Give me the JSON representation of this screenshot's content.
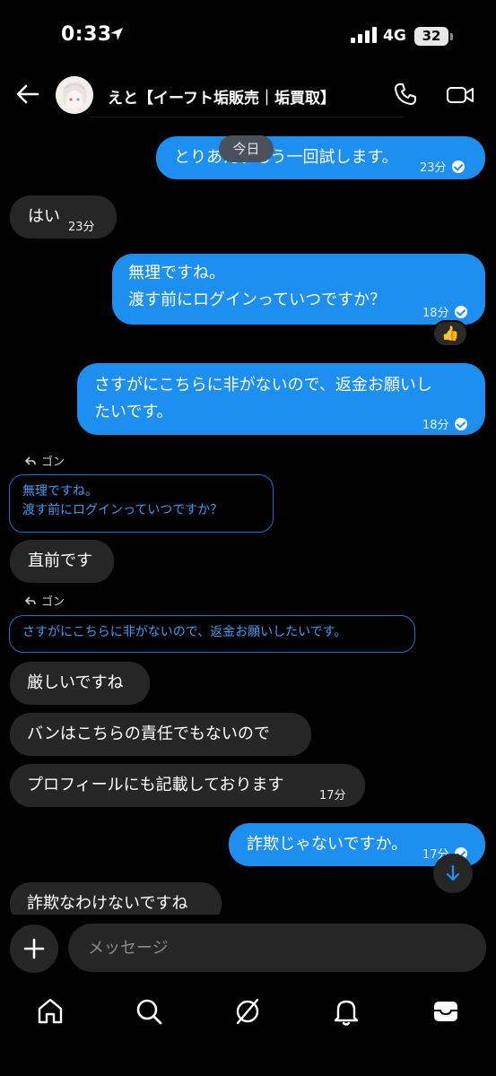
{
  "status_bar": {
    "time": "0:33",
    "network": "4G",
    "battery": "32"
  },
  "header": {
    "contact_name": "えと【イーフト垢販売｜垢買取】"
  },
  "chat": {
    "date_divider": "今日",
    "messages": [
      {
        "direction": "out",
        "text": "とりあえずもう一回試します。",
        "time": "23分",
        "read": true
      },
      {
        "direction": "in",
        "text": "はい",
        "time": "23分"
      },
      {
        "direction": "out",
        "lines": [
          "無理ですね。",
          "渡す前にログインっていつですか？"
        ],
        "time": "18分",
        "read": true,
        "reaction": "👍"
      },
      {
        "direction": "out",
        "lines": [
          "さすがにこちらに非がないので、返金お願いし",
          "たいです。"
        ],
        "time": "18分",
        "read": true
      },
      {
        "direction": "in",
        "reply_label": "ゴン",
        "quote_lines": [
          "無理ですね。",
          "渡す前にログインっていつですか？"
        ],
        "text": "直前です"
      },
      {
        "direction": "in",
        "reply_label": "ゴン",
        "quote_lines": [
          "さすがにこちらに非がないので、返金お願いしたいです。"
        ],
        "text": "厳しいですね"
      },
      {
        "direction": "in",
        "text": "バンはこちらの責任でもないので"
      },
      {
        "direction": "in",
        "text": "プロフィールにも記載しております",
        "time": "17分"
      },
      {
        "direction": "out",
        "text": "詐欺じゃないですか。",
        "time": "17分",
        "read": true
      },
      {
        "direction": "in",
        "text": "詐欺なわけないですね"
      }
    ]
  },
  "composer": {
    "placeholder": "メッセージ"
  },
  "icons": {
    "back": "arrow-left-icon",
    "call": "phone-icon",
    "video": "video-camera-icon",
    "add": "plus-icon",
    "scroll_down": "arrow-down-icon",
    "nav": [
      "home-icon",
      "search-icon",
      "explore-icon",
      "bell-icon",
      "inbox-icon"
    ]
  },
  "colors": {
    "outgoing_bubble": "#1d8ff0",
    "incoming_bubble": "#262626",
    "background": "#000000",
    "quote_text": "#3b9cf5"
  }
}
